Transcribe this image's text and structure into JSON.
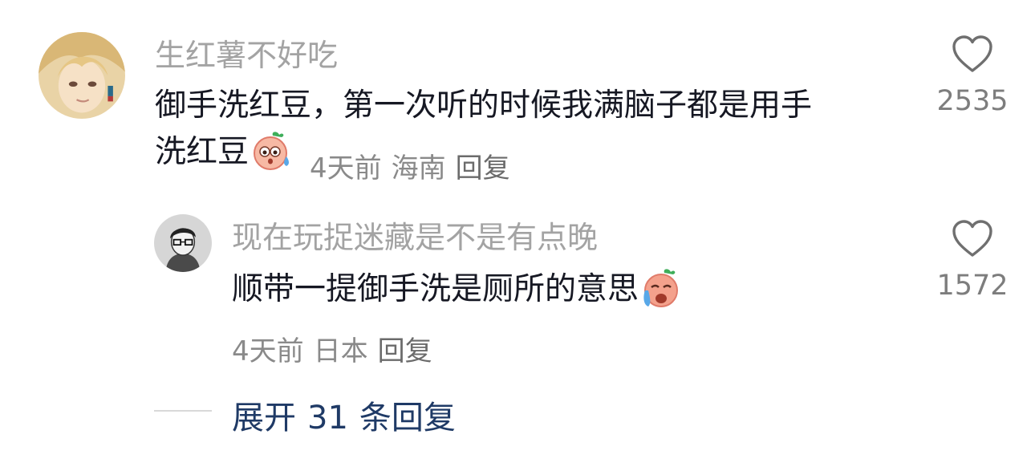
{
  "comment": {
    "username": "生红薯不好吃",
    "text_line1": "御手洗红豆，第一次听的时候我满脑子都是用手",
    "text_line2": "洗红豆",
    "emoji": "sweating-face-emoji",
    "time": "4天前",
    "location": "海南",
    "reply_label": "回复",
    "like_count": "2535"
  },
  "reply": {
    "username": "现在玩捉迷藏是不是有点晚",
    "text": "顺带一提御手洗是厕所的意思",
    "emoji": "crying-laughing-face-emoji",
    "time": "4天前",
    "location": "日本",
    "reply_label": "回复",
    "like_count": "1572"
  },
  "expand": {
    "prefix": "展开",
    "count": "31",
    "suffix": "条回复"
  }
}
